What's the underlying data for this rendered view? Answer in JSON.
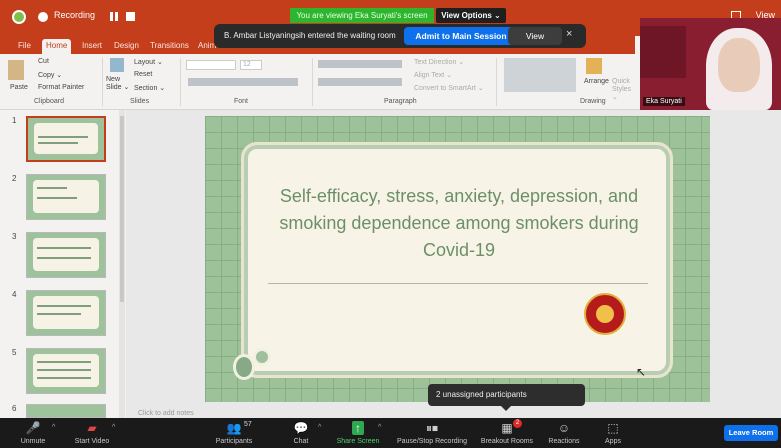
{
  "meeting": {
    "recording_label": "Recording",
    "viewing_banner": "You are viewing Eka Suryati's screen",
    "view_options": "View Options ⌄",
    "window_label": "View"
  },
  "waiting_room": {
    "message": "B. Ambar Listyaningsih entered the waiting room",
    "admit_label": "Admit to Main Session",
    "view_label": "View",
    "close": "×"
  },
  "ppt": {
    "tabs": [
      "File",
      "Home",
      "Insert",
      "Design",
      "Transitions",
      "Anim"
    ],
    "active_tab": "Home",
    "ribbon": {
      "clipboard": {
        "paste": "Paste",
        "cut": "Cut",
        "copy": "Copy ⌄",
        "format_painter": "Format Painter",
        "label": "Clipboard"
      },
      "slides": {
        "new_slide": "New Slide ⌄",
        "layout": "Layout ⌄",
        "reset": "Reset",
        "section": "Section ⌄",
        "label": "Slides"
      },
      "font": {
        "size": "12",
        "label": "Font"
      },
      "paragraph": {
        "text_direction": "Text Direction ⌄",
        "align_text": "Align Text ⌄",
        "smartart": "Convert to SmartArt ⌄",
        "label": "Paragraph"
      },
      "drawing": {
        "arrange": "Arrange",
        "quick_styles": "Quick Styles ⌄",
        "label": "Drawing"
      }
    },
    "slide_numbers": [
      "1",
      "2",
      "3",
      "4",
      "5",
      "6"
    ],
    "slide_title": "Self-efficacy, stress, anxiety, depression, and smoking dependence among smokers during Covid-19",
    "notes_placeholder": "Click to add notes"
  },
  "participant_video": {
    "name": "Eka Suryati"
  },
  "tooltip": {
    "text": "2 unassigned participants"
  },
  "toolbar": {
    "unmute": "Unmute",
    "start_video": "Start Video",
    "participants": "Participants",
    "participants_count": "57",
    "chat": "Chat",
    "share_screen": "Share Screen",
    "pause_recording": "Pause/Stop Recording",
    "breakout_rooms": "Breakout Rooms",
    "breakout_badge": "2",
    "reactions": "Reactions",
    "apps": "Apps",
    "leave": "Leave Room"
  },
  "colors": {
    "ppt_red": "#c43e1c",
    "zoom_blue": "#0e71eb",
    "share_green": "#2fa84f",
    "slide_green": "#9dc29a"
  }
}
